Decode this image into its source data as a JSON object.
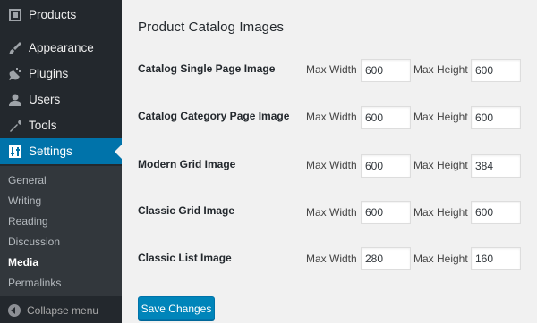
{
  "sidebar": {
    "items": [
      {
        "label": "Products",
        "icon": "products-icon"
      },
      {
        "label": "Appearance",
        "icon": "paintbrush-icon"
      },
      {
        "label": "Plugins",
        "icon": "plug-icon"
      },
      {
        "label": "Users",
        "icon": "user-icon"
      },
      {
        "label": "Tools",
        "icon": "wrench-icon"
      },
      {
        "label": "Settings",
        "icon": "settings-icon",
        "active": true
      }
    ],
    "submenu": [
      "General",
      "Writing",
      "Reading",
      "Discussion",
      "Media",
      "Permalinks"
    ],
    "current_submenu": "Media",
    "collapse_label": "Collapse menu"
  },
  "main": {
    "section_title": "Product Catalog Images",
    "width_label": "Max Width",
    "height_label": "Max Height",
    "rows": [
      {
        "label": "Catalog Single Page Image",
        "width": "600",
        "height": "600"
      },
      {
        "label": "Catalog Category Page Image",
        "width": "600",
        "height": "600"
      },
      {
        "label": "Modern Grid Image",
        "width": "600",
        "height": "384"
      },
      {
        "label": "Classic Grid Image",
        "width": "600",
        "height": "600"
      },
      {
        "label": "Classic List Image",
        "width": "280",
        "height": "160"
      }
    ],
    "save_label": "Save Changes"
  },
  "colors": {
    "sidebar_bg": "#23282d",
    "submenu_bg": "#32373c",
    "accent": "#0073aa",
    "button": "#0085ba"
  }
}
